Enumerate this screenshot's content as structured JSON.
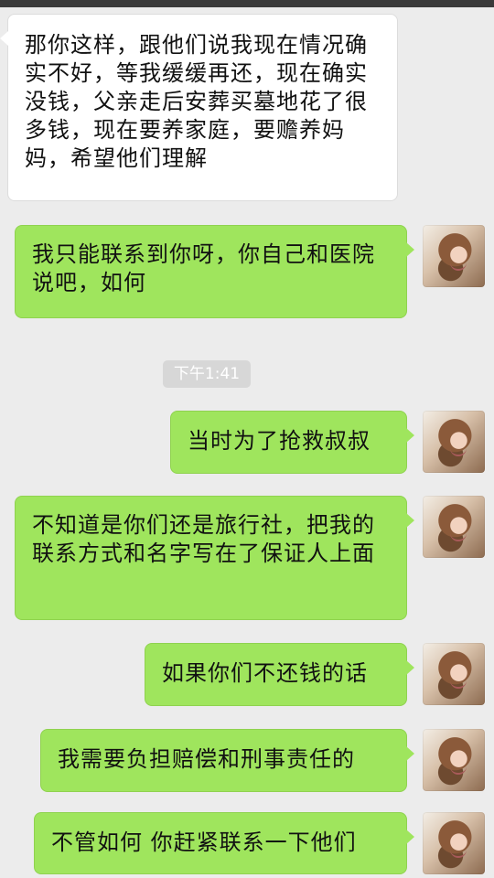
{
  "messages": [
    {
      "direction": "incoming",
      "text": "那你这样，跟他们说我现在情况确实不好，等我缓缓再还，现在确实没钱，父亲走后安葬买墓地花了很多钱，现在要养家庭，要赡养妈妈，希望他们理解"
    },
    {
      "direction": "outgoing",
      "text": "我只能联系到你呀，你自己和医院说吧，如何"
    },
    {
      "direction": "outgoing",
      "text": "当时为了抢救叔叔"
    },
    {
      "direction": "outgoing",
      "text": "不知道是你们还是旅行社，把我的联系方式和名字写在了保证人上面"
    },
    {
      "direction": "outgoing",
      "text": "如果你们不还钱的话"
    },
    {
      "direction": "outgoing",
      "text": "我需要负担赔偿和刑事责任的"
    },
    {
      "direction": "outgoing",
      "text": "不管如何 你赶紧联系一下他们"
    }
  ],
  "timestamp": "下午1:41",
  "colors": {
    "background": "#ececec",
    "incoming_bubble": "#ffffff",
    "outgoing_bubble": "#9fe55d",
    "timestamp_bg": "#d7d7d7",
    "top_bar": "#3a3a3a"
  },
  "icons": {
    "avatar": "profile-photo-avatar"
  }
}
